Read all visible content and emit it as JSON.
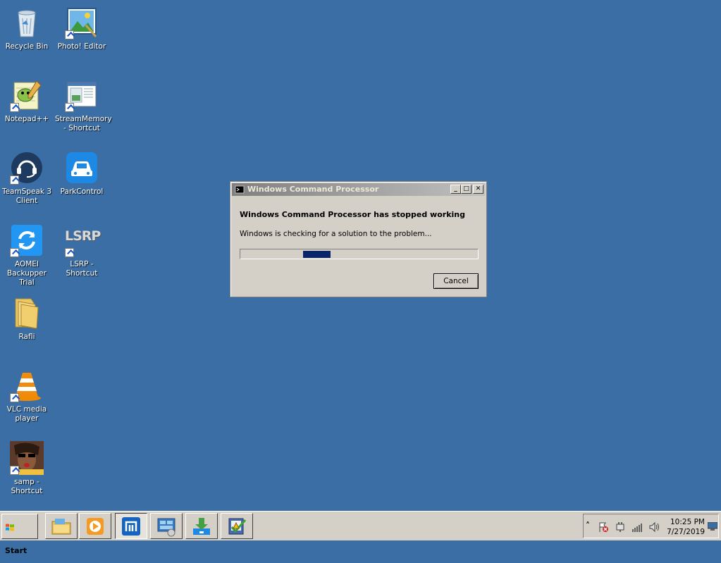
{
  "desktop": {
    "icons": [
      {
        "label": "Recycle Bin"
      },
      {
        "label": "Photo! Editor"
      },
      {
        "label": "Notepad++"
      },
      {
        "label": "StreamMemory - Shortcut"
      },
      {
        "label": "TeamSpeak 3 Client"
      },
      {
        "label": "ParkControl"
      },
      {
        "label": "AOMEI Backupper Trial"
      },
      {
        "label": "LSRP - Shortcut"
      },
      {
        "label": "Rafli"
      },
      {
        "label": "VLC media player"
      },
      {
        "label": "samp - Shortcut"
      }
    ],
    "lsrp_logo_text": "LSRP"
  },
  "dialog": {
    "title": "Windows Command Processor",
    "heading": "Windows Command Processor has stopped working",
    "message": "Windows is checking for a solution to the problem...",
    "cancel_label": "Cancel",
    "minimize_glyph": "_",
    "maximize_glyph": "□",
    "close_glyph": "✕",
    "progress_indicator": "marquee"
  },
  "taskbar": {
    "start_label": "Start",
    "apps": [
      {
        "icon": "file-explorer-icon"
      },
      {
        "icon": "media-player-icon"
      },
      {
        "icon": "maxthon-browser-icon"
      },
      {
        "icon": "control-panel-icon"
      },
      {
        "icon": "download-manager-icon"
      },
      {
        "icon": "task-checker-icon"
      }
    ],
    "tray": {
      "expand_glyph": "˄",
      "time": "10:25 PM",
      "date": "7/27/2019"
    }
  },
  "colors": {
    "desktop_bg": "#3a6ea5",
    "dialog_bg": "#d4d0c8",
    "progress_chunk": "#0a246a"
  }
}
